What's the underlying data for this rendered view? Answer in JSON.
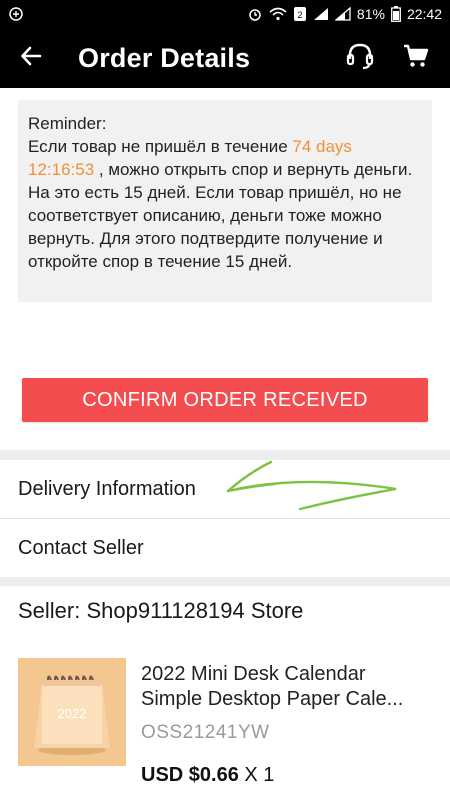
{
  "status_bar": {
    "battery": "81%",
    "time": "22:42"
  },
  "header": {
    "title": "Order Details",
    "back_icon": "arrow-left-icon",
    "support_icon": "headset-icon",
    "cart_icon": "cart-icon"
  },
  "reminder": {
    "heading": "Reminder:",
    "text_1": "Если товар не пришёл в течение ",
    "countdown_days": "74 days",
    "countdown_time": "12:16:53",
    "text_2": " , можно открыть спор и вернуть деньги. На это есть 15 дней.    Если товар пришёл, но не соответствует описанию, деньги тоже можно вернуть. Для этого подтвердите получение и откройте спор в течение 15 дней."
  },
  "actions": {
    "confirm_label": "CONFIRM ORDER RECEIVED"
  },
  "rows": {
    "delivery": "Delivery Information",
    "contact": "Contact Seller"
  },
  "seller": {
    "label": "Seller: Shop911128194 Store"
  },
  "product": {
    "title_line1": "2022 Mini Desk Calendar",
    "title_line2": "Simple Desktop Paper Cale...",
    "image_text": "2022",
    "sku": "OSS21241YW",
    "price": "USD $0.66",
    "quantity": "X 1"
  },
  "colors": {
    "accent_orange": "#f0913a",
    "confirm_red": "#f44d4f",
    "annotation_green": "#7dc242"
  }
}
